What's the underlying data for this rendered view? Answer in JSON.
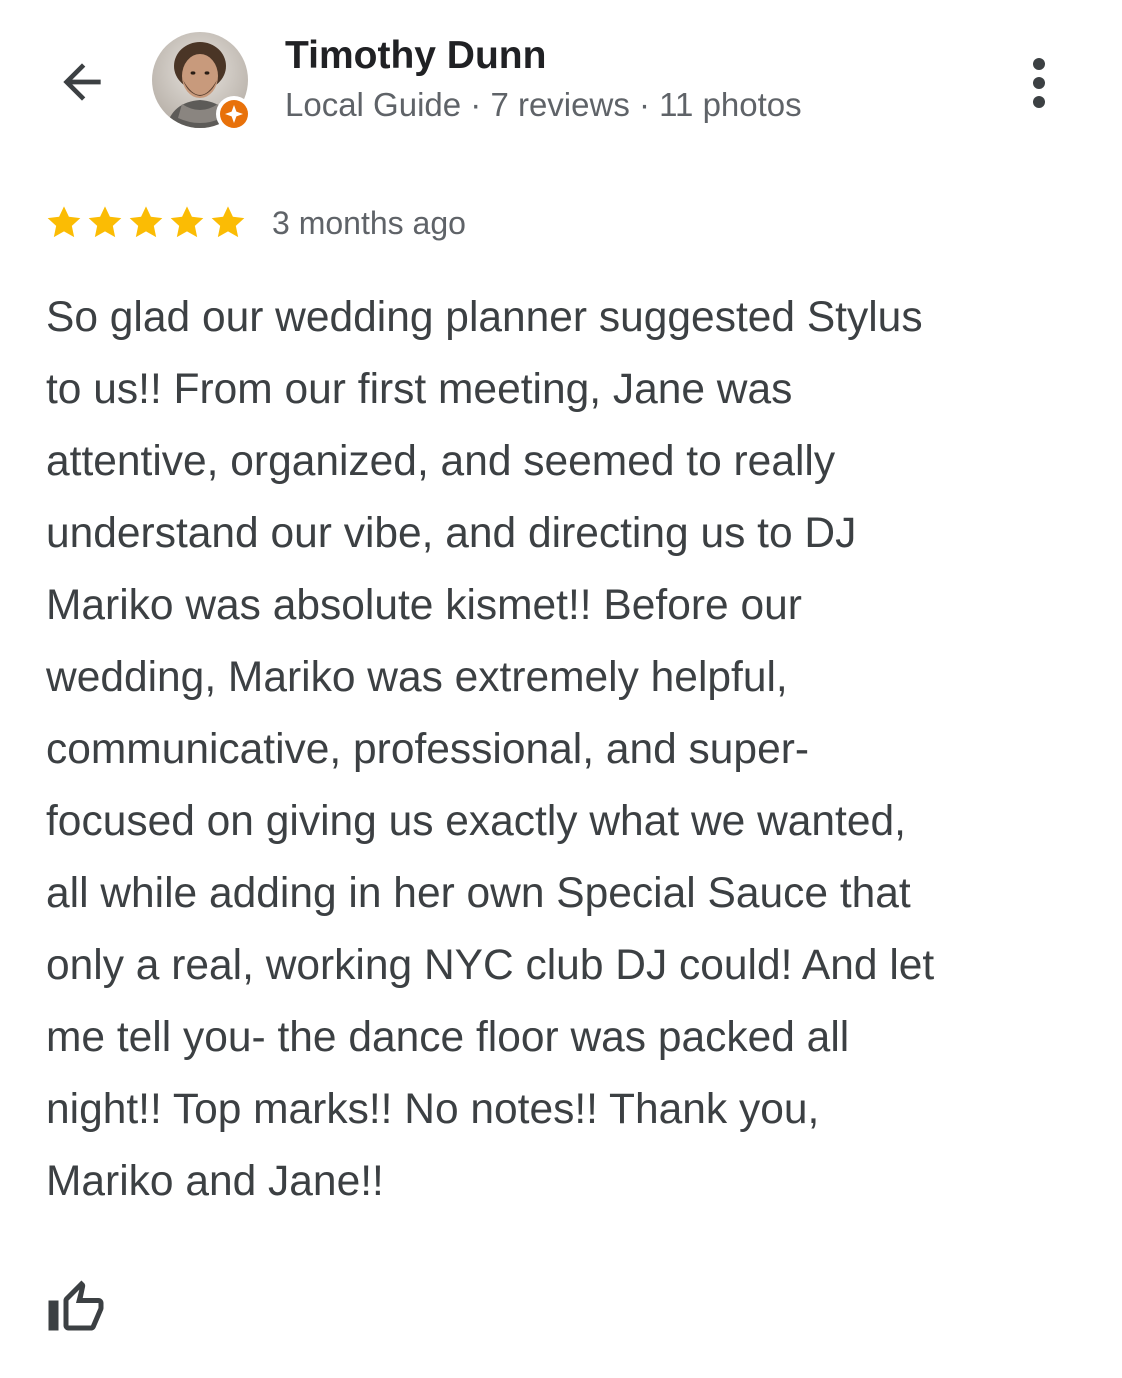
{
  "header": {
    "back_icon": "arrow-back-icon",
    "user_name": "Timothy Dunn",
    "user_meta": "Local Guide · 7 reviews · 11 photos",
    "badge_icon": "local-guide-star-badge-icon",
    "badge_color": "#e8710a",
    "more_icon": "more-vertical-icon"
  },
  "review": {
    "rating": 5,
    "rating_max": 5,
    "star_color": "#fbbc04",
    "time_ago": "3 months ago",
    "text_lines": [
      "So glad our wedding planner suggested Stylus",
      "to us!! From our first meeting, Jane was",
      "attentive, organized, and seemed to really",
      "understand our vibe, and directing us to DJ",
      "Mariko was absolute kismet!! Before our",
      "wedding, Mariko was extremely helpful,",
      "communicative, professional, and super-",
      "focused on giving us exactly what we wanted,",
      "all while adding in her own Special Sauce that",
      "only a real, working NYC club DJ could! And let",
      "me tell you- the dance floor was packed all",
      "night!! Top marks!! No notes!! Thank you,",
      "Mariko and Jane!!"
    ]
  },
  "actions": {
    "like_icon": "thumb-up-outline-icon"
  }
}
